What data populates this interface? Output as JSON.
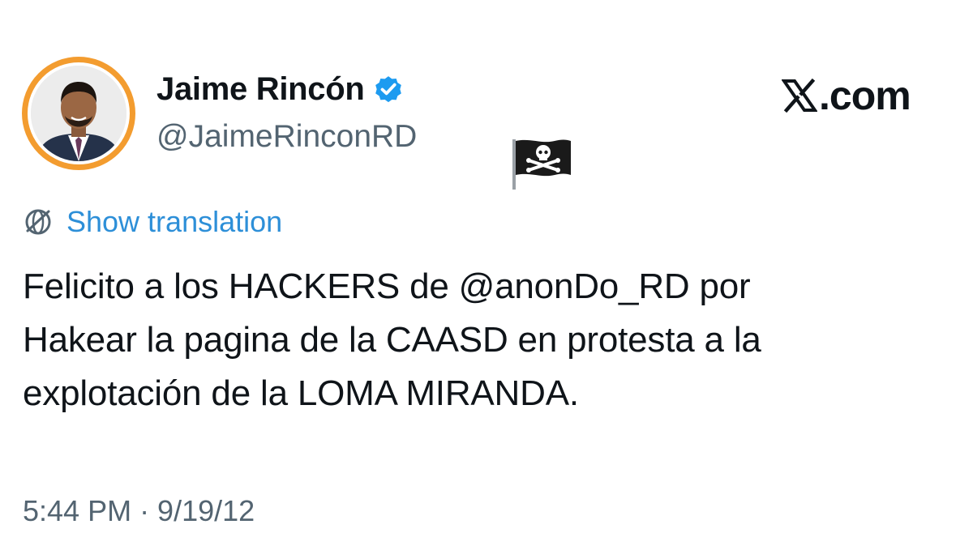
{
  "author": {
    "display_name": "Jaime Rincón",
    "handle": "@JaimeRinconRD",
    "verified": true
  },
  "source_watermark": "X.com",
  "pirate_flag_emoji": "🏴‍☠️",
  "translation": {
    "label": "Show translation"
  },
  "tweet": {
    "text": "Felicito a los HACKERS de @anonDo_RD por\nHakear la pagina de la CAASD en protesta a la\nexplotación de la LOMA MIRANDA."
  },
  "timestamp": "5:44 PM · 9/19/12",
  "icons": {
    "avatar": "profile-photo",
    "verified": "verified-badge-icon",
    "translate": "globe-icon",
    "logo": "x-logo-icon",
    "flag": "pirate-flag-icon"
  },
  "colors": {
    "avatar_ring": "#f39c2f",
    "verified_blue": "#1d9bf0",
    "link_blue": "#2d8fd8",
    "secondary_text": "#536471",
    "primary_text": "#0f1419"
  }
}
